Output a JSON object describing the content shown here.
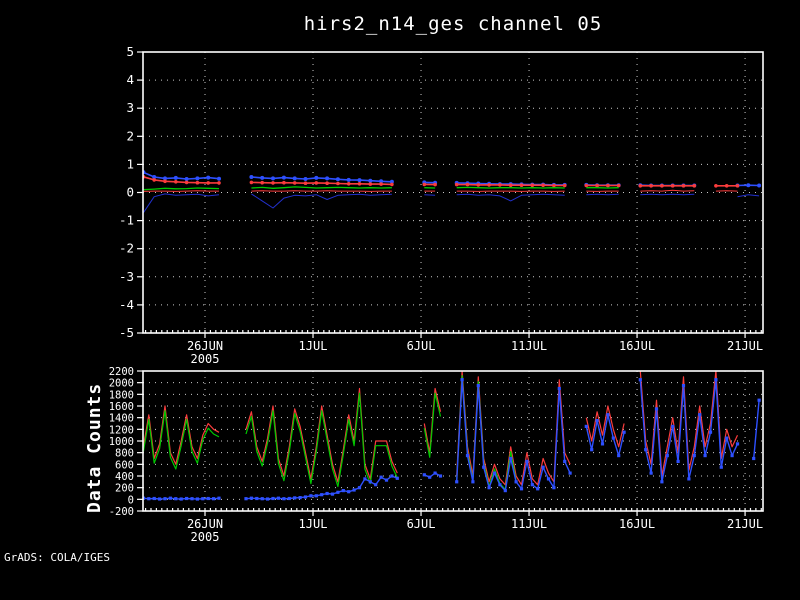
{
  "title": "hirs2_n14_ges channel 05",
  "credit": "GrADS: COLA/IGES",
  "colors": {
    "background": "#000000",
    "frame": "#ffffff",
    "grid": "#c9c9c9",
    "text": "#ffffff",
    "red": "#fa3c3c",
    "green": "#00c800",
    "blue_bright": "#2e50ff",
    "blue_dark": "#2230cc"
  },
  "chart_data": [
    {
      "type": "line",
      "panel": "top",
      "title": "hirs2_n14_ges channel 05",
      "xlabel": "",
      "ylabel": "",
      "grid": true,
      "legend": "none",
      "ylim": [
        -5,
        5
      ],
      "yticks": [
        {
          "v": 5,
          "label": "5"
        },
        {
          "v": 4,
          "label": "4"
        },
        {
          "v": 3,
          "label": "3"
        },
        {
          "v": 2,
          "label": "2"
        },
        {
          "v": 1,
          "label": "1"
        },
        {
          "v": 0,
          "label": "0"
        },
        {
          "v": -1,
          "label": "-1"
        },
        {
          "v": -2,
          "label": "-2"
        },
        {
          "v": -3,
          "label": "-3"
        },
        {
          "v": -4,
          "label": "-4"
        },
        {
          "v": -5,
          "label": "-5"
        }
      ],
      "grid_y": [
        -4,
        -3,
        -2,
        -1,
        0,
        1,
        2,
        3,
        4
      ],
      "xlim_days": [
        0.13,
        28.83
      ],
      "xticks": [
        {
          "day": 3,
          "label": "26JUN",
          "sub": "2005"
        },
        {
          "day": 8,
          "label": "1JUL"
        },
        {
          "day": 13,
          "label": "6JUL"
        },
        {
          "day": 18,
          "label": "11JUL"
        },
        {
          "day": 23,
          "label": "16JUL"
        },
        {
          "day": 28,
          "label": "21JUL"
        }
      ],
      "series": [
        {
          "name": "mean-blue-markers",
          "color": "#2e50ff",
          "width": 1.6,
          "marker": "dot",
          "marker_size": 2.0,
          "x_start": 0.15,
          "x_step": 0.5,
          "values": [
            0.72,
            0.55,
            0.5,
            0.52,
            0.48,
            0.5,
            0.53,
            0.49,
            null,
            null,
            0.55,
            0.52,
            0.5,
            0.53,
            0.5,
            0.48,
            0.52,
            0.5,
            0.47,
            0.45,
            0.44,
            0.42,
            0.4,
            0.38,
            null,
            null,
            0.36,
            0.35,
            null,
            0.34,
            0.33,
            0.32,
            0.31,
            0.3,
            0.3,
            0.29,
            0.28,
            0.28,
            0.27,
            0.27,
            null,
            0.27,
            0.26,
            0.26,
            0.26,
            null,
            0.26,
            0.25,
            0.25,
            0.25,
            0.25,
            0.25,
            null,
            null,
            null,
            0.25,
            0.26,
            0.25,
            0.25
          ]
        },
        {
          "name": "mean-red-markers",
          "color": "#fa3c3c",
          "width": 1.6,
          "marker": "dot",
          "marker_size": 1.8,
          "x_start": 0.15,
          "x_step": 0.5,
          "values": [
            0.56,
            0.45,
            0.4,
            0.38,
            0.36,
            0.35,
            0.34,
            0.34,
            null,
            null,
            0.36,
            0.35,
            0.34,
            0.35,
            0.34,
            0.33,
            0.34,
            0.33,
            0.32,
            0.31,
            0.31,
            0.3,
            0.3,
            0.29,
            null,
            null,
            0.29,
            0.28,
            null,
            0.28,
            0.28,
            0.27,
            0.27,
            0.27,
            0.26,
            0.26,
            0.26,
            0.26,
            0.25,
            0.25,
            null,
            0.25,
            0.25,
            0.25,
            0.25,
            null,
            0.24,
            0.24,
            0.24,
            0.24,
            0.24,
            0.24,
            null,
            0.24,
            0.24,
            0.24,
            null,
            null,
            null
          ]
        },
        {
          "name": "green-line",
          "color": "#00c800",
          "width": 1.3,
          "marker": "none",
          "marker_size": 0,
          "x_start": 0.15,
          "x_step": 0.5,
          "values": [
            0.1,
            0.12,
            0.15,
            0.13,
            0.14,
            0.16,
            0.15,
            0.14,
            null,
            null,
            0.16,
            0.18,
            0.15,
            0.17,
            0.2,
            0.18,
            0.16,
            0.17,
            0.18,
            0.17,
            0.16,
            0.17,
            0.16,
            0.17,
            null,
            null,
            0.17,
            0.16,
            null,
            0.17,
            0.18,
            0.17,
            0.16,
            0.17,
            0.17,
            0.16,
            0.17,
            0.16,
            0.17,
            0.16,
            null,
            0.17,
            0.17,
            0.16,
            0.17,
            null,
            0.17,
            null,
            null,
            null,
            null,
            null,
            null,
            null,
            null,
            null,
            null,
            null,
            null
          ]
        },
        {
          "name": "thin-red-line",
          "color": "#fa3c3c",
          "width": 1.0,
          "marker": "none",
          "marker_size": 0,
          "x_start": 0.15,
          "x_step": 0.5,
          "values": [
            0.04,
            0.05,
            0.05,
            0.04,
            0.05,
            0.06,
            0.05,
            0.05,
            null,
            null,
            0.05,
            0.06,
            0.05,
            0.05,
            0.06,
            0.05,
            0.05,
            0.06,
            0.05,
            0.05,
            0.05,
            0.04,
            0.05,
            0.05,
            null,
            null,
            0.05,
            0.05,
            null,
            0.05,
            0.05,
            0.04,
            0.05,
            0.05,
            0.05,
            0.04,
            0.05,
            0.05,
            0.04,
            0.05,
            null,
            0.05,
            0.04,
            0.05,
            0.05,
            null,
            0.05,
            0.06,
            0.05,
            0.08,
            0.05,
            0.06,
            null,
            0.05,
            0.06,
            0.05,
            null,
            null,
            null
          ]
        },
        {
          "name": "thin-blue-line",
          "color": "#2230cc",
          "width": 1.0,
          "marker": "none",
          "marker_size": 0,
          "x_start": 0.15,
          "x_step": 0.5,
          "values": [
            -0.72,
            -0.15,
            -0.05,
            -0.1,
            -0.08,
            -0.06,
            -0.12,
            -0.08,
            null,
            null,
            -0.05,
            -0.3,
            -0.55,
            -0.2,
            -0.1,
            -0.12,
            -0.08,
            -0.25,
            -0.1,
            -0.08,
            -0.06,
            -0.1,
            -0.08,
            -0.06,
            null,
            null,
            -0.08,
            -0.1,
            null,
            -0.08,
            -0.06,
            -0.1,
            -0.08,
            -0.12,
            -0.3,
            -0.1,
            -0.08,
            -0.06,
            -0.08,
            -0.1,
            null,
            -0.08,
            -0.06,
            -0.08,
            -0.06,
            null,
            -0.08,
            -0.06,
            -0.08,
            -0.06,
            -0.08,
            -0.06,
            null,
            null,
            null,
            -0.15,
            -0.08,
            -0.12,
            -0.1
          ]
        }
      ]
    },
    {
      "type": "line",
      "panel": "bottom",
      "title": "",
      "xlabel": "",
      "ylabel": "Data Counts",
      "grid": true,
      "legend": "none",
      "ylim": [
        -200,
        2200
      ],
      "yticks": [
        {
          "v": 2200,
          "label": "2200"
        },
        {
          "v": 2000,
          "label": "2000"
        },
        {
          "v": 1800,
          "label": "1800"
        },
        {
          "v": 1600,
          "label": "1600"
        },
        {
          "v": 1400,
          "label": "1400"
        },
        {
          "v": 1200,
          "label": "1200"
        },
        {
          "v": 1000,
          "label": "1000"
        },
        {
          "v": 800,
          "label": "800"
        },
        {
          "v": 600,
          "label": "600"
        },
        {
          "v": 400,
          "label": "400"
        },
        {
          "v": 200,
          "label": "200"
        },
        {
          "v": 0,
          "label": "0"
        },
        {
          "v": -200,
          "label": "-200"
        }
      ],
      "grid_y": [
        0,
        200,
        400,
        600,
        800,
        1000,
        1200,
        1400,
        1600,
        1800,
        2000
      ],
      "xlim_days": [
        0.13,
        28.83
      ],
      "xticks": [
        {
          "day": 3,
          "label": "26JUN",
          "sub": "2005"
        },
        {
          "day": 8,
          "label": "1JUL"
        },
        {
          "day": 13,
          "label": "6JUL"
        },
        {
          "day": 18,
          "label": "11JUL"
        },
        {
          "day": 23,
          "label": "16JUL"
        },
        {
          "day": 28,
          "label": "21JUL"
        }
      ],
      "series": [
        {
          "name": "counts-red",
          "color": "#fa3c3c",
          "width": 1.2,
          "marker": "none",
          "marker_size": 0,
          "x_start": 0.15,
          "x_step": 0.25,
          "values": [
            900,
            1450,
            700,
            950,
            1600,
            800,
            600,
            1000,
            1450,
            900,
            700,
            1100,
            1300,
            1200,
            1150,
            null,
            null,
            null,
            null,
            1200,
            1500,
            900,
            650,
            1050,
            1600,
            700,
            400,
            900,
            1550,
            1250,
            800,
            350,
            900,
            1600,
            1100,
            600,
            300,
            850,
            1450,
            1000,
            1900,
            600,
            350,
            1000,
            1000,
            1000,
            650,
            450,
            null,
            null,
            null,
            null,
            1300,
            800,
            1900,
            1500,
            null,
            null,
            400,
            2200,
            900,
            400,
            2100,
            700,
            300,
            600,
            350,
            250,
            900,
            400,
            250,
            800,
            350,
            250,
            700,
            450,
            300,
            2050,
            800,
            600,
            null,
            null,
            1400,
            1000,
            1500,
            1100,
            1600,
            1200,
            900,
            1300,
            null,
            null,
            2200,
            1000,
            600,
            1700,
            400,
            900,
            1400,
            800,
            2100,
            500,
            900,
            1600,
            900,
            1300,
            2200,
            700,
            1200,
            900,
            1100,
            null,
            null,
            null,
            null,
            null,
            null
          ]
        },
        {
          "name": "counts-green",
          "color": "#00c800",
          "width": 1.2,
          "marker": "none",
          "marker_size": 0,
          "x_start": 0.15,
          "x_step": 0.25,
          "values": [
            820,
            1370,
            620,
            870,
            1520,
            720,
            520,
            920,
            1370,
            820,
            620,
            1020,
            1220,
            1120,
            1070,
            null,
            null,
            null,
            null,
            1120,
            1420,
            820,
            570,
            970,
            1520,
            620,
            320,
            820,
            1470,
            1170,
            720,
            270,
            820,
            1520,
            1020,
            520,
            220,
            770,
            1370,
            920,
            1820,
            520,
            270,
            920,
            920,
            920,
            570,
            370,
            null,
            null,
            null,
            null,
            1220,
            720,
            1820,
            1420,
            null,
            null,
            320,
            2120,
            820,
            320,
            2020,
            620,
            220,
            520,
            270,
            170,
            820,
            320,
            null,
            null,
            null,
            null,
            null,
            null,
            null,
            null,
            null,
            null,
            null,
            null,
            null,
            null,
            null,
            null,
            null,
            null,
            null,
            null,
            null,
            null,
            null,
            null,
            null,
            null,
            null,
            null,
            null,
            null,
            null,
            null,
            null,
            null,
            null,
            null,
            null,
            null,
            null,
            null,
            null,
            null,
            null,
            null,
            null,
            null
          ]
        },
        {
          "name": "counts-blue",
          "color": "#2e50ff",
          "width": 1.4,
          "marker": "square",
          "marker_size": 3.2,
          "x_start": 0.15,
          "x_step": 0.25,
          "values": [
            20,
            10,
            15,
            5,
            10,
            20,
            10,
            5,
            15,
            10,
            5,
            10,
            15,
            10,
            20,
            null,
            null,
            null,
            null,
            10,
            20,
            15,
            10,
            5,
            15,
            20,
            10,
            15,
            25,
            30,
            40,
            60,
            60,
            80,
            100,
            90,
            120,
            150,
            130,
            160,
            200,
            350,
            300,
            250,
            380,
            330,
            400,
            360,
            null,
            null,
            null,
            null,
            420,
            380,
            450,
            400,
            null,
            null,
            300,
            2050,
            750,
            300,
            1950,
            550,
            200,
            450,
            250,
            150,
            700,
            300,
            180,
            650,
            250,
            180,
            550,
            350,
            200,
            1900,
            650,
            450,
            null,
            null,
            1250,
            850,
            1350,
            950,
            1450,
            1050,
            750,
            1150,
            null,
            null,
            2050,
            850,
            450,
            1550,
            300,
            750,
            1250,
            650,
            1950,
            350,
            750,
            1450,
            750,
            1150,
            2050,
            550,
            1050,
            750,
            950,
            null,
            null,
            700,
            1700,
            900,
            1100
          ]
        }
      ]
    }
  ]
}
